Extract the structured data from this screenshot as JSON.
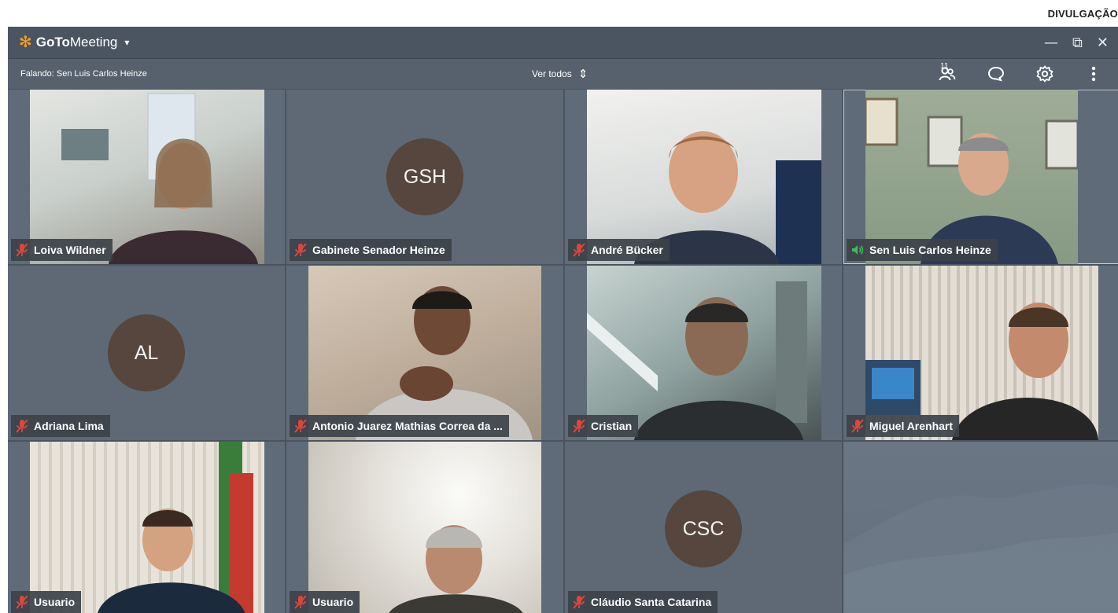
{
  "credit": "DIVULGAÇÃO",
  "app": {
    "brand_bold": "GoTo",
    "brand_regular": "Meeting",
    "brand_caret": "▾",
    "window_controls": {
      "minimize": "—",
      "restore": "⧉",
      "close": "✕"
    }
  },
  "toolbar": {
    "speaking": "Falando: Sen Luis Carlos Heinze",
    "view_all": "Ver todos",
    "view_all_icon": "⇕",
    "attendee_count": "11",
    "icons": [
      "people-icon",
      "chat-icon",
      "gear-icon",
      "more-vertical-icon"
    ]
  },
  "colors": {
    "accent": "#f7a21b",
    "muted_mic": "#e2443a",
    "speaking_indicator": "#39c24f",
    "avatar_bg": "#56463d"
  },
  "participants": [
    {
      "name": "Loiva Wildner",
      "type": "video",
      "muted": true,
      "bg": "#b9c2c4"
    },
    {
      "name": "Gabinete Senador  Heinze",
      "type": "avatar",
      "initials": "GSH",
      "muted": true
    },
    {
      "name": "André Bücker",
      "type": "video",
      "muted": true,
      "bg": "#d6d9d8"
    },
    {
      "name": "Sen Luis Carlos Heinze",
      "type": "video",
      "muted": false,
      "speaking": true,
      "bg": "#8e9f87"
    },
    {
      "name": "Adriana Lima",
      "type": "avatar",
      "initials": "AL",
      "muted": true
    },
    {
      "name": "Antonio Juarez Mathias Correa da ...",
      "type": "video",
      "muted": true,
      "bg": "#a89a8c"
    },
    {
      "name": "Cristian",
      "type": "video",
      "muted": true,
      "bg": "#8c9c99"
    },
    {
      "name": "Miguel Arenhart",
      "type": "video",
      "muted": true,
      "bg": "#cfc9c2"
    },
    {
      "name": "Usuario",
      "type": "video",
      "muted": true,
      "bg": "#cdc8bd"
    },
    {
      "name": "Usuario",
      "type": "video",
      "muted": true,
      "bg": "#d5d2cc"
    },
    {
      "name": "Cláudio Santa Catarina",
      "type": "avatar",
      "initials": "CSC",
      "muted": true
    }
  ]
}
